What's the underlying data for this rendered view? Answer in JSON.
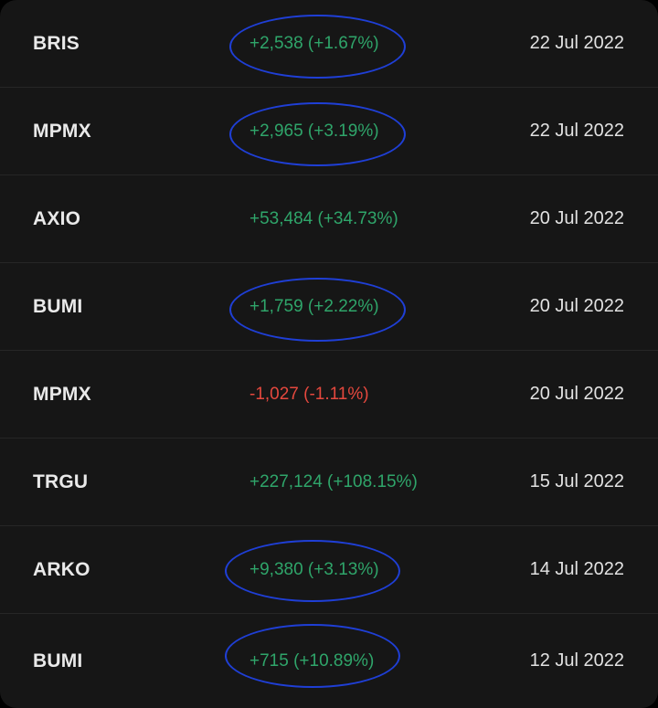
{
  "rows": [
    {
      "ticker": "BRIS",
      "change": "+2,538 (+1.67%)",
      "direction": "up",
      "date": "22 Jul 2022",
      "circled": true
    },
    {
      "ticker": "MPMX",
      "change": "+2,965 (+3.19%)",
      "direction": "up",
      "date": "22 Jul 2022",
      "circled": true
    },
    {
      "ticker": "AXIO",
      "change": "+53,484 (+34.73%)",
      "direction": "up",
      "date": "20 Jul 2022",
      "circled": false
    },
    {
      "ticker": "BUMI",
      "change": "+1,759 (+2.22%)",
      "direction": "up",
      "date": "20 Jul 2022",
      "circled": true
    },
    {
      "ticker": "MPMX",
      "change": "-1,027 (-1.11%)",
      "direction": "down",
      "date": "20 Jul 2022",
      "circled": false
    },
    {
      "ticker": "TRGU",
      "change": "+227,124 (+108.15%)",
      "direction": "up",
      "date": "15 Jul 2022",
      "circled": false
    },
    {
      "ticker": "ARKO",
      "change": "+9,380 (+3.13%)",
      "direction": "up",
      "date": "14 Jul 2022",
      "circled": true
    },
    {
      "ticker": "BUMI",
      "change": "+715 (+10.89%)",
      "direction": "up",
      "date": "12 Jul 2022",
      "circled": true
    }
  ],
  "colors": {
    "background": "#161616",
    "positive": "#2fa56a",
    "negative": "#e5483e",
    "annotation": "#1f3fd6"
  }
}
